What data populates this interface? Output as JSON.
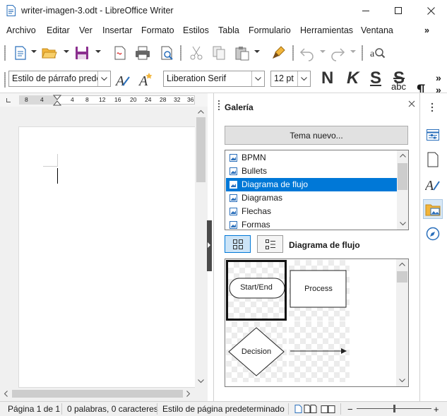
{
  "window": {
    "title": "writer-imagen-3.odt - LibreOffice Writer",
    "controls": {
      "minimize": "—",
      "maximize": "☐",
      "close": "✕"
    }
  },
  "menubar": {
    "items": [
      {
        "label": "Archivo"
      },
      {
        "label": "Editar"
      },
      {
        "label": "Ver"
      },
      {
        "label": "Insertar"
      },
      {
        "label": "Formato"
      },
      {
        "label": "Estilos"
      },
      {
        "label": "Tabla"
      },
      {
        "label": "Formulario"
      },
      {
        "label": "Herramientas"
      },
      {
        "label": "Ventana"
      }
    ],
    "overflow": "»"
  },
  "toolbar": {
    "overflow": "»",
    "paragraph_style": "Estilo de párrafo predet",
    "font_name": "Liberation Serif",
    "font_size": "12 pt",
    "bold_glyph": "N",
    "italic_glyph": "K",
    "underline_glyph": "S",
    "strike_glyph": "S",
    "spelling_glyph": "abc",
    "pilcrow_glyph": "¶"
  },
  "ruler": {
    "ticks": [
      "8",
      "4",
      "4",
      "8",
      "12",
      "16",
      "20",
      "24",
      "28",
      "32",
      "36"
    ]
  },
  "sidebar": {
    "deck_title": "Galería",
    "new_theme_button": "Tema nuevo...",
    "themes": [
      {
        "label": "BPMN",
        "selected": false
      },
      {
        "label": "Bullets",
        "selected": false
      },
      {
        "label": "Diagrama de flujo",
        "selected": true
      },
      {
        "label": "Diagramas",
        "selected": false
      },
      {
        "label": "Flechas",
        "selected": false
      },
      {
        "label": "Formas",
        "selected": false
      }
    ],
    "current_theme": "Diagrama de flujo",
    "items": [
      {
        "label": "Start/End"
      },
      {
        "label": "Process"
      },
      {
        "label": "Decision"
      }
    ],
    "tabs": [
      "properties-icon",
      "page-icon",
      "styles-icon",
      "gallery-icon",
      "navigator-icon"
    ]
  },
  "statusbar": {
    "page": "Página 1 de 1",
    "words": "0 palabras, 0 caracteres",
    "page_style": "Estilo de página predeterminado",
    "zoom_minus": "−",
    "zoom_plus": "+"
  },
  "colors": {
    "accent": "#0078d7",
    "selection": "#0078d7",
    "save_icon": "#8b2f8f",
    "bold_text": "#333333"
  }
}
